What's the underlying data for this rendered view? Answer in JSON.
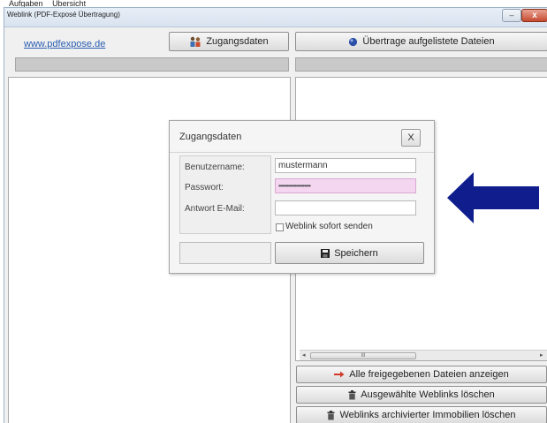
{
  "background_app": {
    "tabs": [
      "Aufgaben",
      "Übersicht"
    ]
  },
  "window": {
    "title": "Weblink (PDF-Exposé Übertragung)",
    "minimize_glyph": "–",
    "close_glyph": "x"
  },
  "toolbar": {
    "link_text": "www.pdfexpose.de",
    "access_button_label": "Zugangsdaten",
    "transfer_button_label": "Übertrage aufgelistete Dateien"
  },
  "dialog": {
    "title": "Zugangsdaten",
    "close_label": "X",
    "username_label": "Benutzername:",
    "username_value": "mustermann",
    "password_label": "Passwort:",
    "password_value": "••••••••••••••••••••",
    "reply_email_label": "Antwort E-Mail:",
    "reply_email_value": "",
    "send_now_label": "Weblink sofort senden",
    "send_now_checked": false,
    "save_label": "Speichern"
  },
  "actions": {
    "show_shared_label": "Alle freigegebenen Dateien anzeigen",
    "delete_selected_label": "Ausgewählte Weblinks löschen",
    "delete_archived_label": "Weblinks archivierter Immobilien löschen"
  },
  "colors": {
    "arrow": "#0f1e8c",
    "link": "#2a5db0",
    "password_highlight": "#f5d6f1",
    "show_shared_icon": "#d23a2a"
  },
  "icons": {
    "access_button": "people-icon",
    "transfer_button": "blue-globe-icon",
    "save_button": "floppy-disk-icon",
    "show_shared": "red-arrow-icon",
    "delete_selected": "trash-icon",
    "delete_archived": "trash-icon",
    "pointer": "left-arrow-icon"
  }
}
